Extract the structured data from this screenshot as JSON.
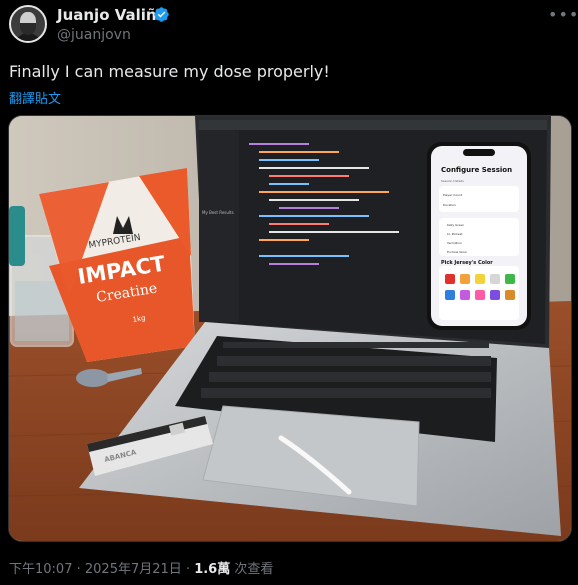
{
  "author": {
    "name": "Juanjo Valiño",
    "handle": "@juanjovn",
    "verified": true
  },
  "tweet": {
    "text": "Finally I can measure my dose properly!",
    "translate_label": "翻譯貼文"
  },
  "media": {
    "package_brand": "MYPROTEIN",
    "package_title": "IMPACT",
    "package_subtitle": "Creatine",
    "package_weight": "1kg",
    "card_text": "ABANCA",
    "phone_title": "Configure Session",
    "phone_section": "Pick Jersey's Color",
    "phone_rows": [
      "Session Details",
      "Player Count",
      "Duration"
    ],
    "phone_list": [
      "Kelly Green",
      "Lt. Pinkest",
      "Vermillion",
      "Fuchsia Glow"
    ],
    "jersey_colors": [
      "#e0312b",
      "#f3a23b",
      "#f5d23a",
      "#d6d6d6",
      "#3fb84a",
      "#2f7fe0",
      "#c35ae0",
      "#ff5aa5",
      "#7b4de0",
      "#d98a2b"
    ],
    "xcode_sidebar": "My Best Results"
  },
  "footer": {
    "time": "下午10:07",
    "separator": " · ",
    "date": "2025年7月21日",
    "views_count": "1.6萬",
    "views_label": " 次查看"
  },
  "colors": {
    "accent": "#1d9bf0",
    "muted": "#71767b",
    "text": "#e7e9ea",
    "background": "#000000"
  },
  "icons": {
    "more": "more-horizontal-icon",
    "verified": "verified-badge-icon"
  }
}
